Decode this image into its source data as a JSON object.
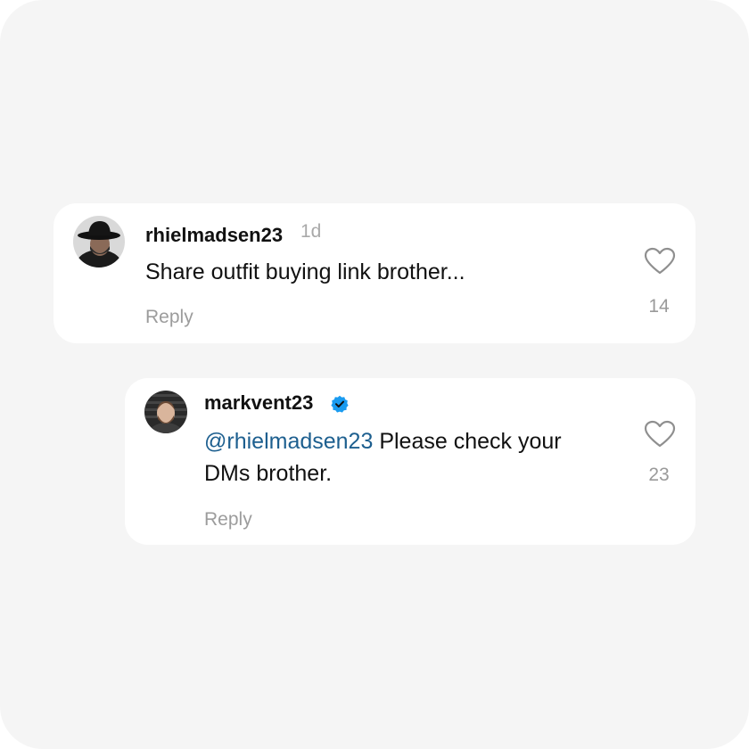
{
  "comments": [
    {
      "username": "rhielmadsen23",
      "timestamp": "1d",
      "text": "Share outfit buying link brother...",
      "reply_label": "Reply",
      "like_count": "14",
      "avatar_icon": "avatar-man-hat",
      "like_icon": "heart-outline-icon"
    },
    {
      "username": "markvent23",
      "verified": true,
      "verified_icon": "verified-badge-icon",
      "mention": "@rhielmadsen23",
      "text": "Please check your DMs brother.",
      "reply_label": "Reply",
      "like_count": "23",
      "avatar_icon": "avatar-man-beard",
      "like_icon": "heart-outline-icon"
    }
  ],
  "colors": {
    "background": "#f5f5f5",
    "card": "#ffffff",
    "mention": "#1d5f8f",
    "verified": "#1a9bf0",
    "muted": "#9c9c9c"
  }
}
